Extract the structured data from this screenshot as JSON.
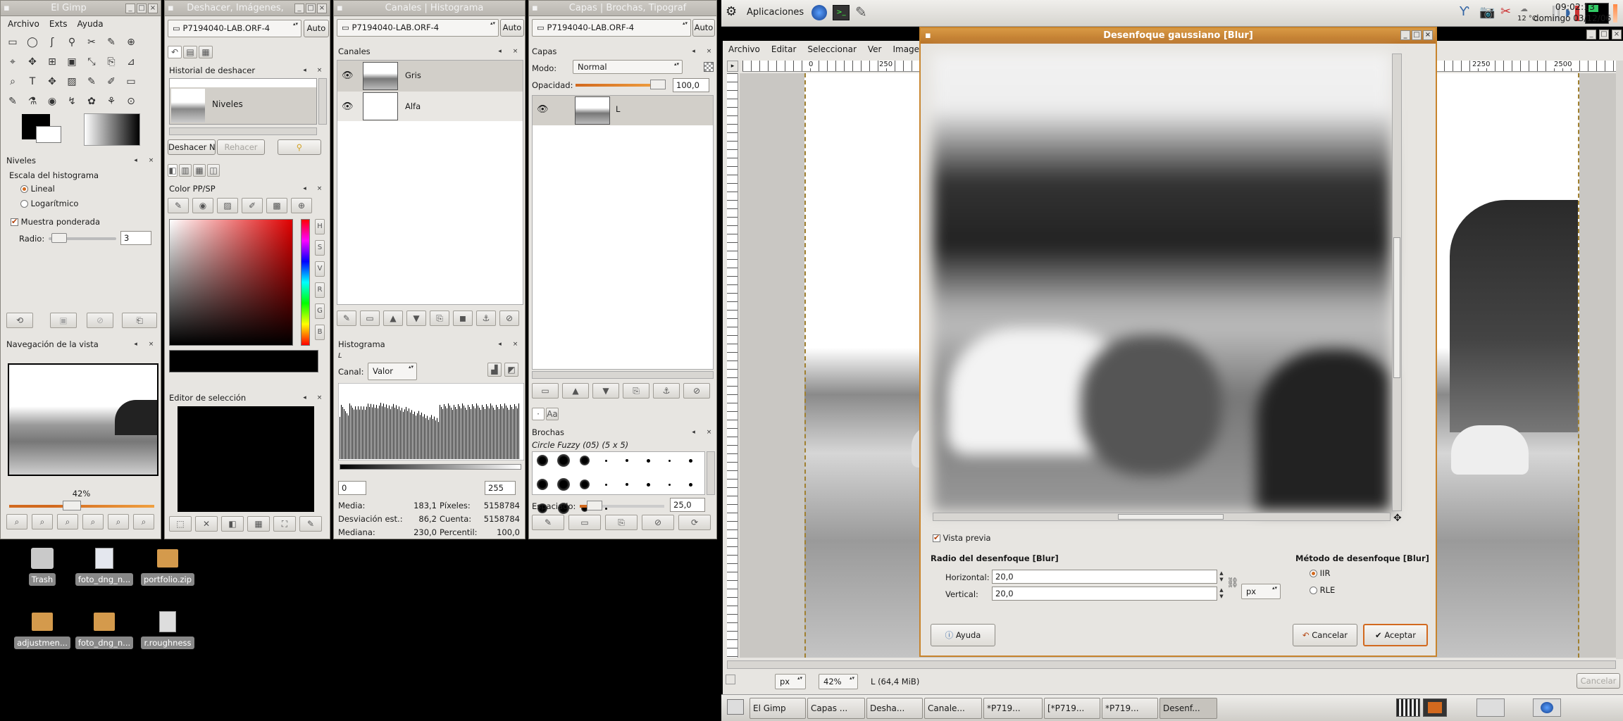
{
  "desktop": {
    "icons": [
      {
        "label": "Trash",
        "icon": "trash-icon"
      },
      {
        "label": "foto_dng_n...",
        "icon": "image-file-icon"
      },
      {
        "label": "portfolio.zip",
        "icon": "archive-icon"
      },
      {
        "label": "adjustmen...",
        "icon": "archive-icon"
      },
      {
        "label": "foto_dng_n...",
        "icon": "archive-icon"
      },
      {
        "label": "r.roughness",
        "icon": "script-file-icon"
      }
    ]
  },
  "toolbox": {
    "title": "El Gimp",
    "menu": [
      "Archivo",
      "Exts",
      "Ayuda"
    ],
    "levels": {
      "title": "Niveles",
      "scale_label": "Escala del histograma",
      "linear": "Lineal",
      "log": "Logarítmico",
      "weighted": "Muestra ponderada",
      "radius_label": "Radio:",
      "radius_value": "3"
    },
    "nav": {
      "title": "Navegación de la vista",
      "zoom": "42%"
    }
  },
  "undo": {
    "title": "Deshacer, Imágenes,",
    "image": "P7194040-LAB.ORF-4",
    "auto": "Auto",
    "history_title": "Historial de deshacer",
    "item": "Niveles",
    "undo_btn": "Deshacer N",
    "redo_btn": "Rehacer",
    "color_title": "Color PP/SP",
    "color_side": [
      "H",
      "S",
      "V",
      "R",
      "G",
      "B"
    ],
    "sel_title": "Editor de selección"
  },
  "channels": {
    "title": "Canales | Histograma",
    "image": "P7194040-LAB.ORF-4",
    "auto": "Auto",
    "panel_title": "Canales",
    "items": [
      "Gris",
      "Alfa"
    ],
    "hist_title": "Histograma",
    "hist_layer": "L",
    "canal_label": "Canal:",
    "canal_value": "Valor",
    "range_min": "0",
    "range_max": "255",
    "stats": [
      {
        "k": "Media:",
        "v": "183,1",
        "k2": "Píxeles:",
        "v2": "5158784"
      },
      {
        "k": "Desviación est.:",
        "v": "86,2",
        "k2": "Cuenta:",
        "v2": "5158784"
      },
      {
        "k": "Mediana:",
        "v": "230,0",
        "k2": "Percentil:",
        "v2": "100,0"
      }
    ]
  },
  "layers": {
    "title": "Capas | Brochas, Tipograf",
    "image": "P7194040-LAB.ORF-4",
    "auto": "Auto",
    "panel_title": "Capas",
    "mode_label": "Modo:",
    "mode_value": "Normal",
    "opacity_label": "Opacidad:",
    "opacity_value": "100,0",
    "layer_name": "L",
    "brushes_title": "Brochas",
    "brush_name": "Circle Fuzzy (05) (5 x 5)",
    "spacing_label": "Espaciado:",
    "spacing_value": "25,0"
  },
  "panel": {
    "apps": "Aplicaciones",
    "temp": "12 °C",
    "time": "09:02:13",
    "date": "domingo 03/12/06"
  },
  "image_window": {
    "menu": [
      "Archivo",
      "Editar",
      "Seleccionar",
      "Ver",
      "Imagen"
    ],
    "ruler": [
      "0",
      "250",
      "2250",
      "2500"
    ],
    "unit": "px",
    "zoom": "42%",
    "status": "L (64,4 MiB)",
    "cancel": "Cancelar"
  },
  "blur_dialog": {
    "title": "Desenfoque gaussiano [Blur]",
    "preview_label": "Vista previa",
    "radius_title": "Radio del desenfoque [Blur]",
    "horizontal_label": "Horizontal:",
    "horizontal_value": "20,0",
    "vertical_label": "Vertical:",
    "vertical_value": "20,0",
    "unit": "px",
    "method_title": "Método de desenfoque [Blur]",
    "method_iir": "IIR",
    "method_rle": "RLE",
    "help": "Ayuda",
    "cancel": "Cancelar",
    "ok": "Aceptar"
  },
  "taskbar": [
    "El Gimp",
    "Capas ...",
    "Desha...",
    "Canale...",
    "*P719...",
    "[*P719...",
    "*P719...",
    "Desenf..."
  ]
}
